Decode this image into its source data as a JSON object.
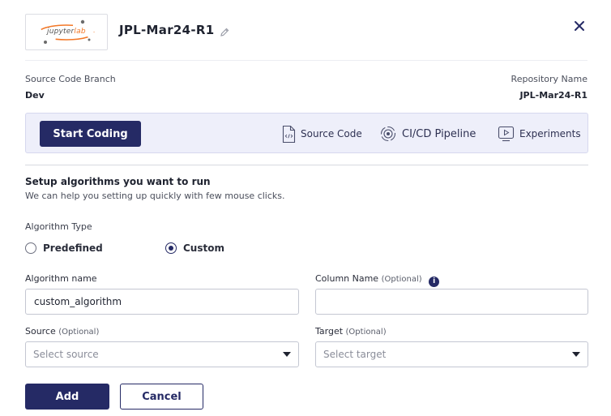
{
  "header": {
    "logo_text_main": "jupyter",
    "logo_text_accent": "lab",
    "title": "JPL-Mar24-R1",
    "edit_icon": "pencil-icon",
    "close_icon": "close-icon"
  },
  "meta": {
    "branch_label": "Source Code Branch",
    "branch_value": "Dev",
    "repo_label": "Repository Name",
    "repo_value": "JPL-Mar24-R1"
  },
  "actions": {
    "start_label": "Start Coding",
    "links": [
      {
        "label": "Source Code",
        "icon": "file-code-icon"
      },
      {
        "label": "CI/CD Pipeline",
        "icon": "pipeline-icon"
      },
      {
        "label": "Experiments",
        "icon": "play-screen-icon"
      }
    ]
  },
  "setup": {
    "title": "Setup algorithms you want to run",
    "subtitle": "We can help you setting up quickly with few mouse clicks."
  },
  "algorithm_type": {
    "label": "Algorithm Type",
    "options": [
      {
        "label": "Predefined",
        "selected": false
      },
      {
        "label": "Custom",
        "selected": true
      }
    ]
  },
  "form": {
    "algorithm_name_label": "Algorithm name",
    "algorithm_name_value": "custom_algorithm",
    "column_name_label": "Column Name",
    "column_name_optional": "(Optional)",
    "column_name_info": "i",
    "source_label": "Source",
    "source_optional": "(Optional)",
    "source_placeholder": "Select source",
    "target_label": "Target",
    "target_optional": "(Optional)",
    "target_placeholder": "Select target"
  },
  "buttons": {
    "add_label": "Add",
    "cancel_label": "Cancel"
  },
  "colors": {
    "primary": "#252a65",
    "accent_orange": "#f37726",
    "bar_background": "#eeeffa"
  }
}
